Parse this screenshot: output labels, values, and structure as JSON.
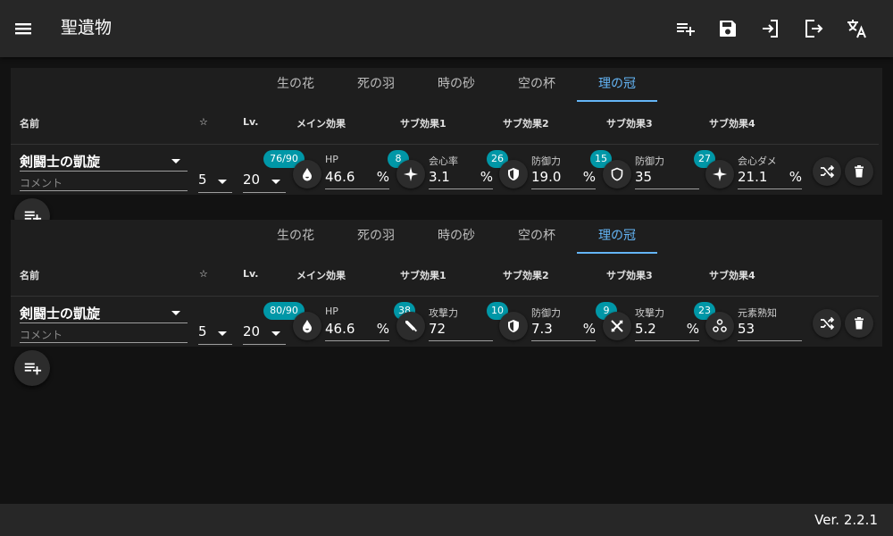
{
  "app": {
    "title": "聖遺物"
  },
  "toolbar": {
    "menu_icon": "menu-icon",
    "buttons": [
      "playlist-add-icon",
      "save-icon",
      "import-icon",
      "export-icon",
      "translate-icon"
    ]
  },
  "tabs": [
    "生の花",
    "死の羽",
    "時の砂",
    "空の杯",
    "理の冠"
  ],
  "active_tab": "理の冠",
  "headers": {
    "name": "名前",
    "star": "☆",
    "level": "Lv.",
    "main": "メイン効果",
    "sub1": "サブ効果1",
    "sub2": "サブ効果2",
    "sub3": "サブ効果3",
    "sub4": "サブ効果4"
  },
  "artifacts": [
    {
      "name": "剣闘士の凱旋",
      "comment_placeholder": "コメント",
      "stars": "5",
      "level": "20",
      "level_badge": "76/90",
      "main": {
        "label": "HP",
        "value": "46.6",
        "unit": "%",
        "icon": "hp-drop-icon"
      },
      "subs": [
        {
          "roll": "8",
          "label": "会心率",
          "value": "3.1",
          "unit": "%",
          "icon": "crit-sparkle-icon"
        },
        {
          "roll": "26",
          "label": "防御力",
          "value": "19.0",
          "unit": "%",
          "icon": "def-shield-icon"
        },
        {
          "roll": "15",
          "label": "防御力",
          "value": "35",
          "unit": "",
          "icon": "def-shield-outline-icon"
        },
        {
          "roll": "27",
          "label": "会心ダメ",
          "value": "21.1",
          "unit": "%",
          "icon": "crit-sparkle-icon"
        }
      ]
    },
    {
      "name": "剣闘士の凱旋",
      "comment_placeholder": "コメント",
      "stars": "5",
      "level": "20",
      "level_badge": "80/90",
      "main": {
        "label": "HP",
        "value": "46.6",
        "unit": "%",
        "icon": "hp-drop-icon"
      },
      "subs": [
        {
          "roll": "38",
          "label": "攻撃力",
          "value": "72",
          "unit": "",
          "icon": "atk-sword-icon"
        },
        {
          "roll": "10",
          "label": "防御力",
          "value": "7.3",
          "unit": "%",
          "icon": "def-shield-icon"
        },
        {
          "roll": "9",
          "label": "攻撃力",
          "value": "5.2",
          "unit": "%",
          "icon": "atk-crossed-swords-icon"
        },
        {
          "roll": "23",
          "label": "元素熟知",
          "value": "53",
          "unit": "",
          "icon": "elemental-mastery-icon"
        }
      ]
    }
  ],
  "footer": {
    "version": "Ver. 2.2.1"
  }
}
